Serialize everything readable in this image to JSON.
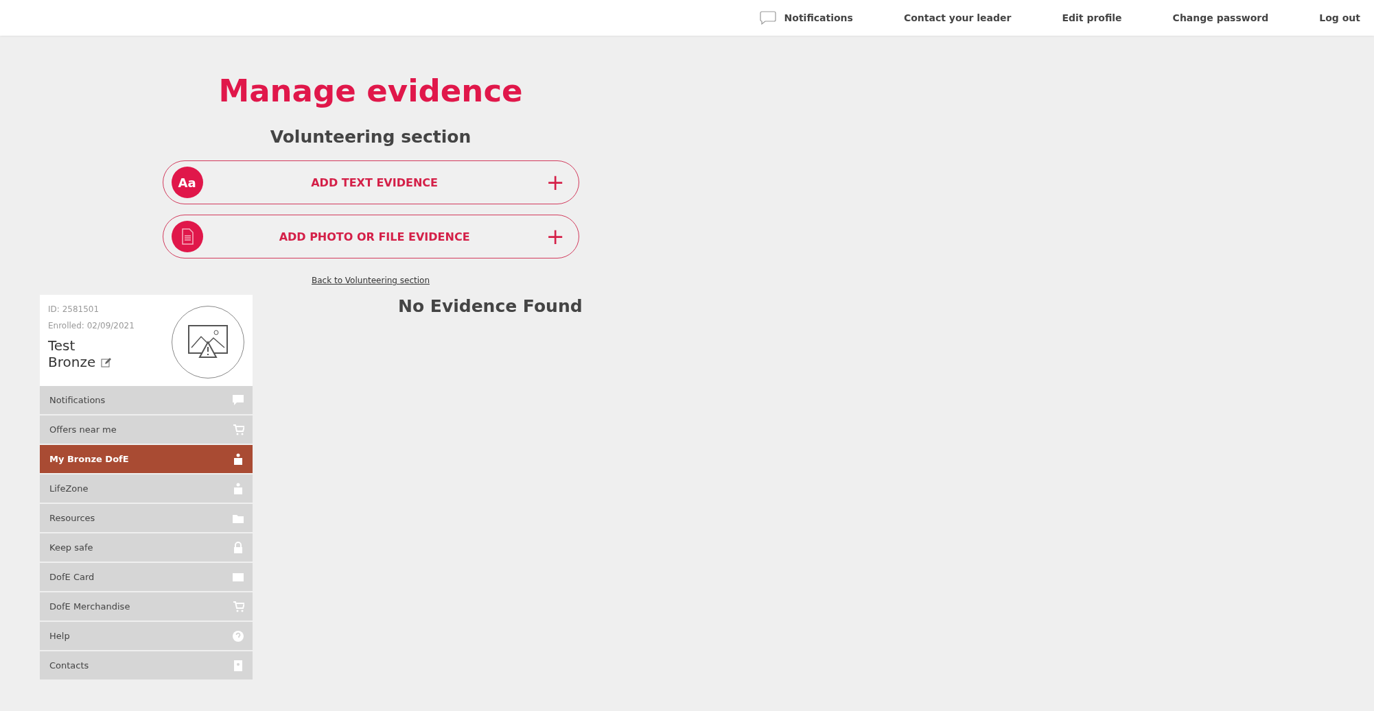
{
  "top_nav": [
    {
      "label": "Notifications",
      "kind": "notifications"
    },
    {
      "label": "Contact your leader",
      "kind": "link"
    },
    {
      "label": "Edit profile",
      "kind": "link"
    },
    {
      "label": "Change password",
      "kind": "link"
    },
    {
      "label": "Log out",
      "kind": "link"
    }
  ],
  "title": "Manage evidence",
  "subtitle": "Volunteering section",
  "actions": [
    {
      "label": "ADD TEXT EVIDENCE",
      "kind": "text",
      "badge": "Aa",
      "action_icon": "+"
    },
    {
      "label": "ADD PHOTO OR FILE EVIDENCE",
      "kind": "file",
      "action_icon": "+"
    }
  ],
  "back_link": "Back to Volunteering section",
  "profile": {
    "id": "ID: 2581501",
    "enrolled": "Enrolled: 02/09/2021",
    "first_name": "Test",
    "last_name": "Bronze"
  },
  "sidebar": {
    "items": [
      {
        "label": "Notifications",
        "selected": false
      },
      {
        "label": "Offers near me",
        "selected": false
      },
      {
        "label": "My Bronze DofE",
        "selected": true
      },
      {
        "label": "LifeZone",
        "selected": false
      },
      {
        "label": "Resources",
        "selected": false
      },
      {
        "label": "Keep safe",
        "selected": false
      },
      {
        "label": "DofE Card",
        "selected": false
      },
      {
        "label": "DofE Merchandise",
        "selected": false
      },
      {
        "label": "Help",
        "selected": false
      },
      {
        "label": "Contacts",
        "selected": false
      }
    ]
  },
  "empty_message": "No Evidence Found"
}
